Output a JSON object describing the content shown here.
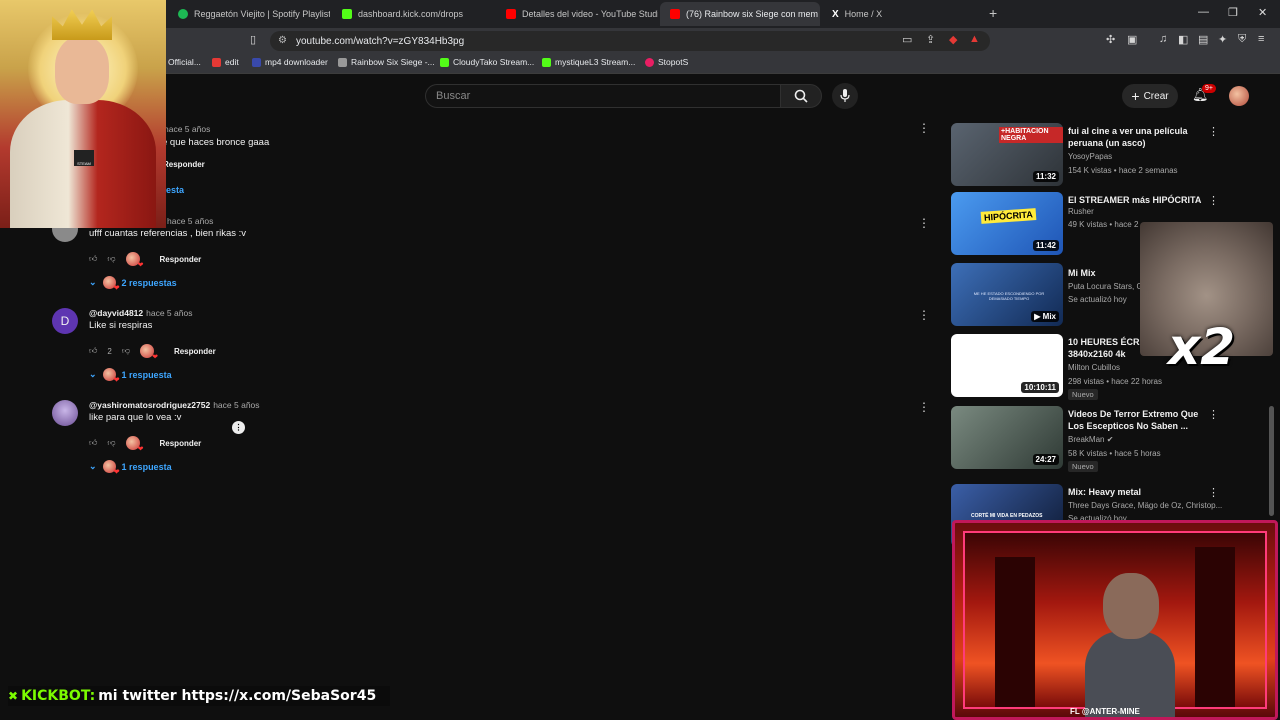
{
  "browser": {
    "tabs": [
      {
        "label": "Reggaetón Viejito | Spotify Playlist",
        "color": "#1db954",
        "active": false
      },
      {
        "label": "dashboard.kick.com/drops",
        "color": "#53fc18",
        "active": false
      },
      {
        "label": "Detalles del video - YouTube Studio",
        "color": "#ff0000",
        "active": false
      },
      {
        "label": "(76) Rainbow six Siege con mem",
        "color": "#ff0000",
        "active": true
      },
      {
        "label": "Home / X",
        "color": "#ffffff",
        "active": false
      }
    ],
    "new_tab_label": "+",
    "url": "youtube.com/watch?v=zGY834Hb3pg",
    "bookmarks": [
      {
        "label": "Official...",
        "color": "#ff0000"
      },
      {
        "label": "edit",
        "color": "#e53935"
      },
      {
        "label": "mp4 downloader",
        "color": "#3949ab"
      },
      {
        "label": "Rainbow Six Siege -...",
        "color": "#999999"
      },
      {
        "label": "CloudyTako Stream...",
        "color": "#53fc18"
      },
      {
        "label": "mystiqueL3 Stream...",
        "color": "#53fc18"
      },
      {
        "label": "StopotS",
        "color": "#e91e63"
      }
    ]
  },
  "youtube": {
    "search_placeholder": "Buscar",
    "create_label": "Crear",
    "notifications_badge": "9+"
  },
  "comments": [
    {
      "author": "",
      "time": "hace 5 años",
      "text": "e que haces bronce gaaa",
      "likes": "",
      "reply_label": "Responder",
      "replies": "esta",
      "avatar_color": "#666666"
    },
    {
      "author": "",
      "time": "hace 5 años",
      "text": "ufff cuantas referencias , bien rikas :v",
      "likes": "",
      "reply_label": "Responder",
      "replies": "2 respuestas",
      "avatar_color": "#888888"
    },
    {
      "author": "@dayvid4812",
      "time": "hace 5 años",
      "text": "Like si respiras",
      "likes": "2",
      "reply_label": "Responder",
      "replies": "1 respuesta",
      "avatar_color": "#5e35b1",
      "avatar_letter": "D"
    },
    {
      "author": "@yashiromatosrodriguez2752",
      "time": "hace 5 años",
      "text": "like para que lo vea :v",
      "likes": "",
      "reply_label": "Responder",
      "replies": "1 respuesta",
      "avatar_color": "#8e7cc3"
    }
  ],
  "videos": [
    {
      "title": "fui al cine a ver una película peruana (un asco)",
      "channel": "YosoyPapas",
      "meta": "154 K vistas • hace 2 semanas",
      "duration": "11:32",
      "badge": "",
      "thumb": "#3a3f47"
    },
    {
      "title": "El STREAMER más HIPÓCRITA",
      "channel": "Rusher",
      "meta": "49 K vistas • hace 2",
      "duration": "11:42",
      "badge": "",
      "thumb": "#2d6fd6"
    },
    {
      "title": "Mi Mix",
      "channel": "Puta Locura Stars, G",
      "meta": "Se actualizó hoy",
      "duration": "Mix",
      "badge": "",
      "thumb": "#1f3f7a"
    },
    {
      "title": "10 HEURES ÉCRA 4K 3840x2160 4k",
      "channel": "Milton Cubillos",
      "meta": "298 vistas • hace 22 horas",
      "duration": "10:10:11",
      "badge": "Nuevo",
      "thumb": "#ffffff"
    },
    {
      "title": "Videos De Terror Extremo Que Los Escepticos No Saben ...",
      "channel": "BreakMan",
      "meta": "58 K vistas • hace 5 horas",
      "duration": "24:27",
      "badge": "Nuevo",
      "thumb": "#55605a"
    },
    {
      "title": "Mix: Heavy metal",
      "channel": "Three Days Grace, Mägo de Oz, Christop...",
      "meta": "Se actualizó hoy",
      "duration": "",
      "badge": "",
      "thumb": "#23386e"
    }
  ],
  "thumb_texts": {
    "v1": "+HABITACION NEGRA",
    "v2": "HIPÓCRITA",
    "v3": "ME HE ESTADO ESCONDIENDO POR DEMASIADO TIEMPO",
    "v6": "CORTÉ MI VIDA EN PEDAZOS"
  },
  "overlays": {
    "ticker_brand": "KICKBOT:",
    "ticker_text": "mi twitter https://x.com/SebaSor45",
    "multiplier": "x2",
    "cam_caption": "FL @ANTER-MINE",
    "gaben_label": "STEAM"
  }
}
